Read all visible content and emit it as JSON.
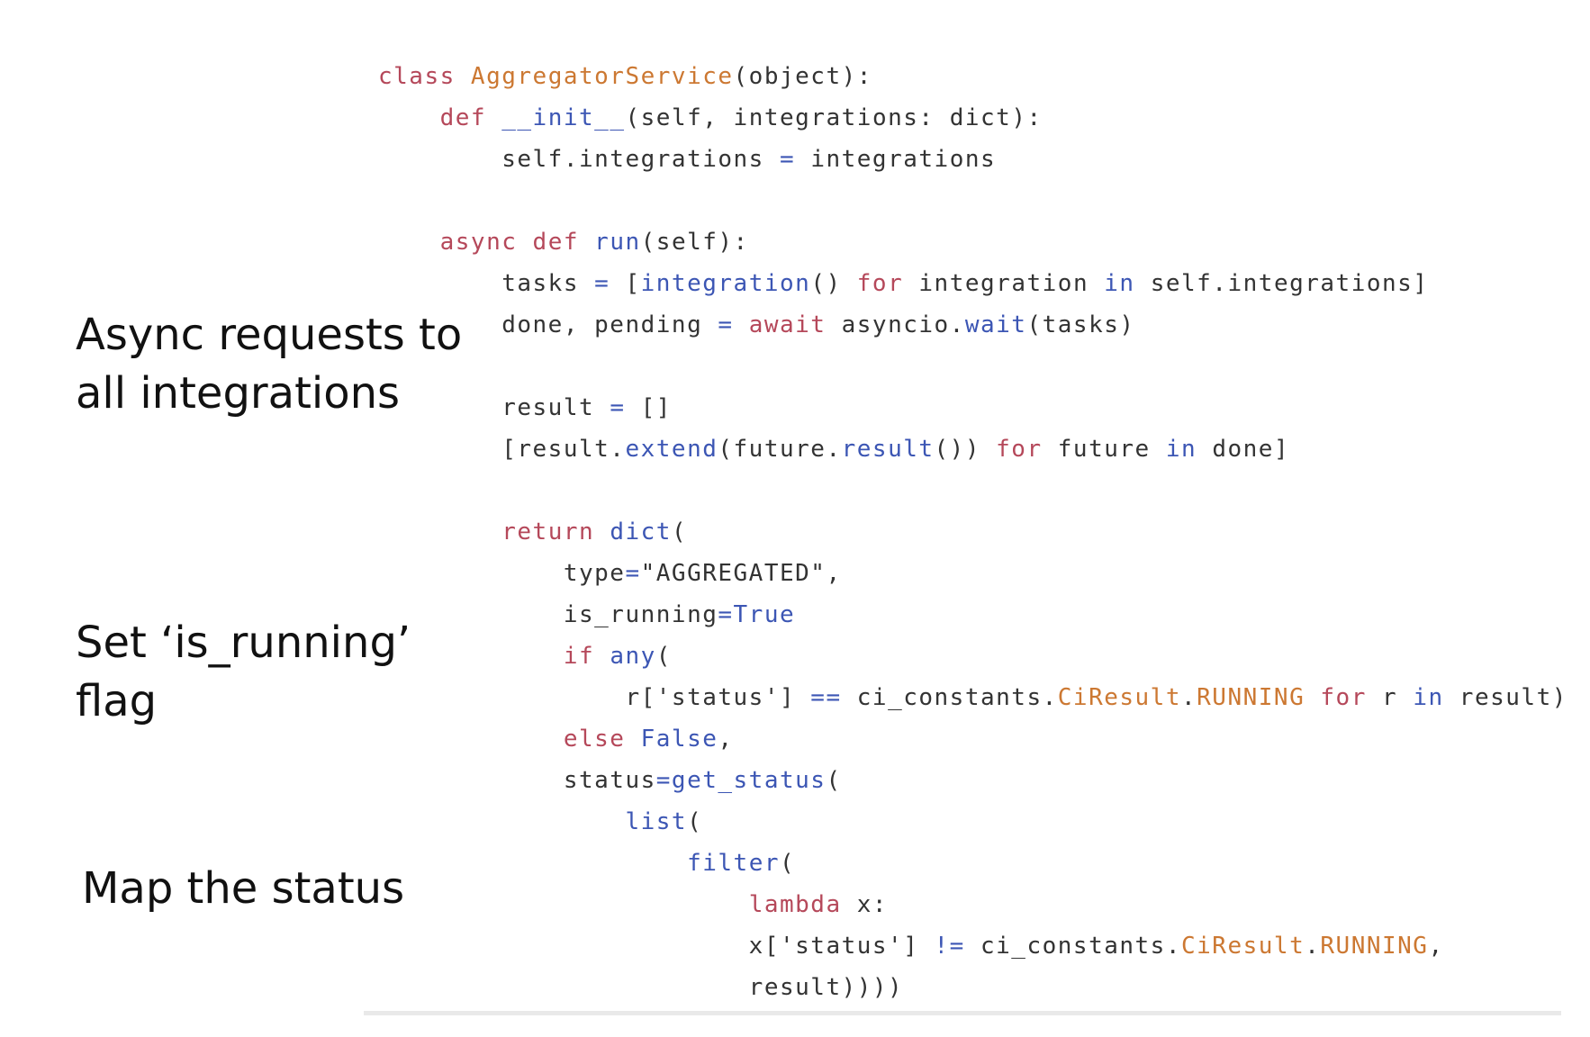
{
  "annotations": {
    "async_requests": [
      "Async requests to",
      "all integrations"
    ],
    "is_running": [
      "Set ‘is_running’",
      "flag"
    ],
    "map_status": [
      "Map the status"
    ]
  },
  "colors": {
    "keyword": "#b5485a",
    "class_name": "#cc7832",
    "function": "#3c56b4",
    "default": "#333333",
    "constant": "#cc7832",
    "divider": "#e9e9e9"
  },
  "code": {
    "language": "python",
    "lines": [
      [
        {
          "t": "class ",
          "c": "keyword"
        },
        {
          "t": "AggregatorService",
          "c": "class_name"
        },
        {
          "t": "(object):",
          "c": "default"
        }
      ],
      [
        {
          "t": "    ",
          "c": "default"
        },
        {
          "t": "def ",
          "c": "keyword"
        },
        {
          "t": "__init__",
          "c": "function"
        },
        {
          "t": "(self, integrations: dict):",
          "c": "default"
        }
      ],
      [
        {
          "t": "        self.integrations ",
          "c": "default"
        },
        {
          "t": "= ",
          "c": "function"
        },
        {
          "t": "integrations",
          "c": "default"
        }
      ],
      [],
      [
        {
          "t": "    ",
          "c": "default"
        },
        {
          "t": "async ",
          "c": "keyword"
        },
        {
          "t": "def ",
          "c": "keyword"
        },
        {
          "t": "run",
          "c": "function"
        },
        {
          "t": "(self):",
          "c": "default"
        }
      ],
      [
        {
          "t": "        tasks ",
          "c": "default"
        },
        {
          "t": "= ",
          "c": "function"
        },
        {
          "t": "[",
          "c": "default"
        },
        {
          "t": "integration",
          "c": "function"
        },
        {
          "t": "() ",
          "c": "default"
        },
        {
          "t": "for ",
          "c": "keyword"
        },
        {
          "t": "integration ",
          "c": "default"
        },
        {
          "t": "in ",
          "c": "function"
        },
        {
          "t": "self.integrations]",
          "c": "default"
        }
      ],
      [
        {
          "t": "        done, pending ",
          "c": "default"
        },
        {
          "t": "= ",
          "c": "function"
        },
        {
          "t": "await ",
          "c": "keyword"
        },
        {
          "t": "asyncio.",
          "c": "default"
        },
        {
          "t": "wait",
          "c": "function"
        },
        {
          "t": "(tasks)",
          "c": "default"
        }
      ],
      [],
      [
        {
          "t": "        result ",
          "c": "default"
        },
        {
          "t": "= ",
          "c": "function"
        },
        {
          "t": "[]",
          "c": "default"
        }
      ],
      [
        {
          "t": "        [result.",
          "c": "default"
        },
        {
          "t": "extend",
          "c": "function"
        },
        {
          "t": "(future.",
          "c": "default"
        },
        {
          "t": "result",
          "c": "function"
        },
        {
          "t": "()) ",
          "c": "default"
        },
        {
          "t": "for ",
          "c": "keyword"
        },
        {
          "t": "future ",
          "c": "default"
        },
        {
          "t": "in ",
          "c": "function"
        },
        {
          "t": "done]",
          "c": "default"
        }
      ],
      [],
      [
        {
          "t": "        ",
          "c": "default"
        },
        {
          "t": "return ",
          "c": "keyword"
        },
        {
          "t": "dict",
          "c": "function"
        },
        {
          "t": "(",
          "c": "default"
        }
      ],
      [
        {
          "t": "            type",
          "c": "default"
        },
        {
          "t": "=",
          "c": "function"
        },
        {
          "t": "\"AGGREGATED\",",
          "c": "default"
        }
      ],
      [
        {
          "t": "            is_running",
          "c": "default"
        },
        {
          "t": "=True",
          "c": "function"
        }
      ],
      [
        {
          "t": "            ",
          "c": "default"
        },
        {
          "t": "if ",
          "c": "keyword"
        },
        {
          "t": "any",
          "c": "function"
        },
        {
          "t": "(",
          "c": "default"
        }
      ],
      [
        {
          "t": "                r['status'] ",
          "c": "default"
        },
        {
          "t": "== ",
          "c": "function"
        },
        {
          "t": "ci_constants.",
          "c": "default"
        },
        {
          "t": "CiResult",
          "c": "constant"
        },
        {
          "t": ".",
          "c": "default"
        },
        {
          "t": "RUNNING ",
          "c": "constant"
        },
        {
          "t": "for ",
          "c": "keyword"
        },
        {
          "t": "r ",
          "c": "default"
        },
        {
          "t": "in ",
          "c": "function"
        },
        {
          "t": "result)",
          "c": "default"
        }
      ],
      [
        {
          "t": "            ",
          "c": "default"
        },
        {
          "t": "else ",
          "c": "keyword"
        },
        {
          "t": "False",
          "c": "function"
        },
        {
          "t": ",",
          "c": "default"
        }
      ],
      [
        {
          "t": "            status",
          "c": "default"
        },
        {
          "t": "=get_status",
          "c": "function"
        },
        {
          "t": "(",
          "c": "default"
        }
      ],
      [
        {
          "t": "                ",
          "c": "default"
        },
        {
          "t": "list",
          "c": "function"
        },
        {
          "t": "(",
          "c": "default"
        }
      ],
      [
        {
          "t": "                    ",
          "c": "default"
        },
        {
          "t": "filter",
          "c": "function"
        },
        {
          "t": "(",
          "c": "default"
        }
      ],
      [
        {
          "t": "                        ",
          "c": "default"
        },
        {
          "t": "lambda ",
          "c": "keyword"
        },
        {
          "t": "x:",
          "c": "default"
        }
      ],
      [
        {
          "t": "                        x['status'] ",
          "c": "default"
        },
        {
          "t": "!= ",
          "c": "function"
        },
        {
          "t": "ci_constants.",
          "c": "default"
        },
        {
          "t": "CiResult",
          "c": "constant"
        },
        {
          "t": ".",
          "c": "default"
        },
        {
          "t": "RUNNING",
          "c": "constant"
        },
        {
          "t": ",",
          "c": "default"
        }
      ],
      [
        {
          "t": "                        result))))",
          "c": "default"
        }
      ]
    ]
  }
}
